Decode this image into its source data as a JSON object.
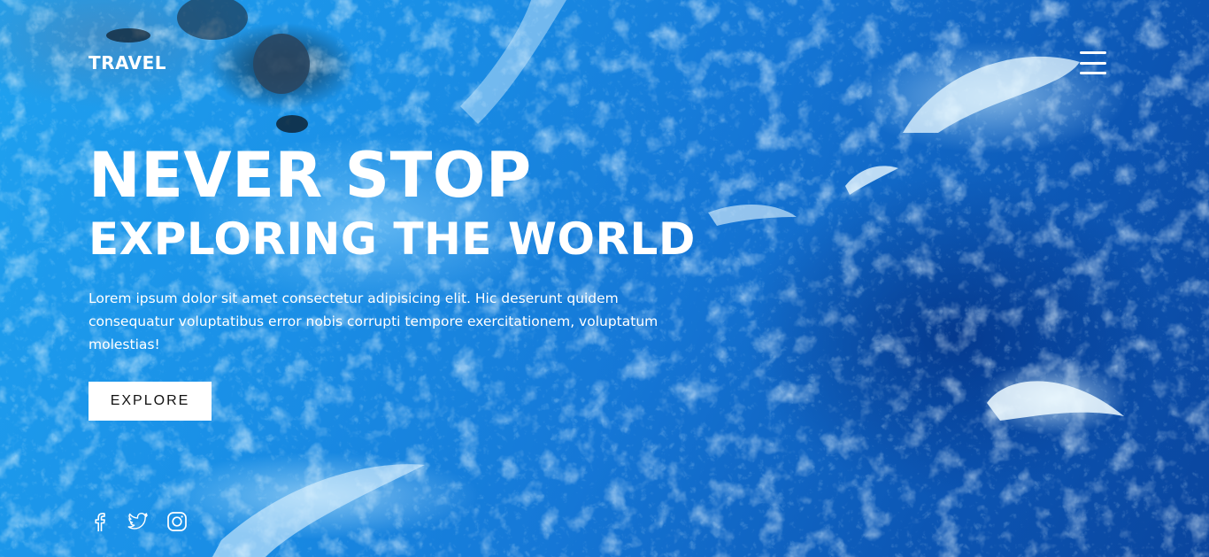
{
  "header": {
    "logo": "TRAVEL",
    "menu_icon": "hamburger-menu-icon"
  },
  "hero": {
    "title_line1": "NEVER STOP",
    "title_line2": "EXPLORING THE WORLD",
    "description": "Lorem ipsum dolor sit amet consectetur adipisicing elit. Hic deserunt quidem consequatur voluptatibus error nobis corrupti tempore exercitationem, voluptatum molestias!",
    "cta_label": "EXPLORE"
  },
  "social": {
    "icons": [
      "facebook-icon",
      "twitter-icon",
      "instagram-icon"
    ]
  },
  "colors": {
    "text": "#ffffff",
    "button_bg": "#ffffff",
    "button_text": "#111111",
    "ocean_light": "#1fa2f0",
    "ocean_dark": "#0a459e"
  }
}
